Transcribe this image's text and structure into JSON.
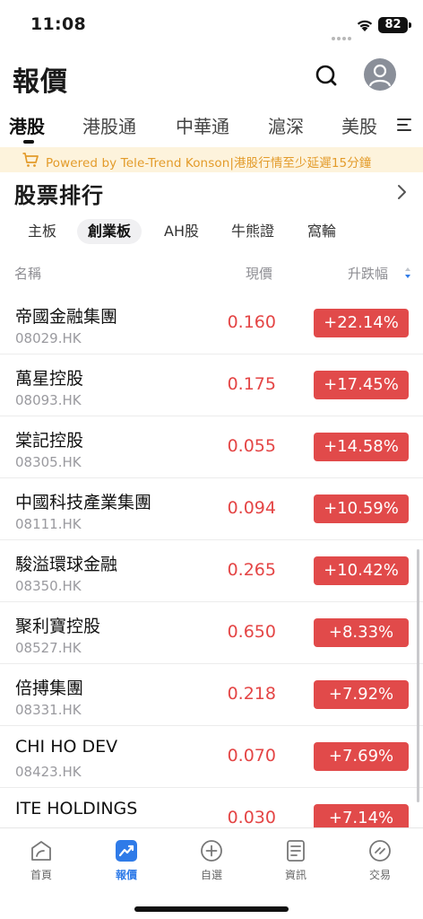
{
  "status_bar": {
    "time": "11:08",
    "battery": "82"
  },
  "header": {
    "title": "報價"
  },
  "market_tabs": [
    {
      "label": "港股",
      "active": true
    },
    {
      "label": "港股通",
      "active": false
    },
    {
      "label": "中華通",
      "active": false
    },
    {
      "label": "滬深",
      "active": false
    },
    {
      "label": "美股",
      "active": false
    }
  ],
  "notice": {
    "text": "Powered by Tele-Trend Konson|港股行情至少延遲15分鐘"
  },
  "section": {
    "title": "股票排行"
  },
  "board_tabs": [
    {
      "label": "主板",
      "active": false
    },
    {
      "label": "創業板",
      "active": true
    },
    {
      "label": "AH股",
      "active": false
    },
    {
      "label": "牛熊證",
      "active": false
    },
    {
      "label": "窩輪",
      "active": false
    }
  ],
  "table_header": {
    "name": "名稱",
    "price": "現價",
    "change": "升跌幅"
  },
  "stocks": [
    {
      "name": "帝國金融集團",
      "code": "08029.HK",
      "price": "0.160",
      "change": "+22.14%"
    },
    {
      "name": "萬星控股",
      "code": "08093.HK",
      "price": "0.175",
      "change": "+17.45%"
    },
    {
      "name": "棠記控股",
      "code": "08305.HK",
      "price": "0.055",
      "change": "+14.58%"
    },
    {
      "name": "中國科技產業集團",
      "code": "08111.HK",
      "price": "0.094",
      "change": "+10.59%"
    },
    {
      "name": "駿溢環球金融",
      "code": "08350.HK",
      "price": "0.265",
      "change": "+10.42%"
    },
    {
      "name": "聚利寶控股",
      "code": "08527.HK",
      "price": "0.650",
      "change": "+8.33%"
    },
    {
      "name": "倍搏集團",
      "code": "08331.HK",
      "price": "0.218",
      "change": "+7.92%"
    },
    {
      "name": "CHI HO DEV",
      "code": "08423.HK",
      "price": "0.070",
      "change": "+7.69%"
    },
    {
      "name": "ITE HOLDINGS",
      "code": "",
      "price": "0.030",
      "change": "+7.14%"
    }
  ],
  "bottom_nav": [
    {
      "label": "首頁",
      "icon": "home-icon",
      "active": false
    },
    {
      "label": "報價",
      "icon": "quotes-chart-icon",
      "active": true
    },
    {
      "label": "自選",
      "icon": "add-circle-icon",
      "active": false
    },
    {
      "label": "資訊",
      "icon": "news-icon",
      "active": false
    },
    {
      "label": "交易",
      "icon": "trade-icon",
      "active": false
    }
  ],
  "colors": {
    "up_red": "#e14a4a",
    "price_red": "#e44545",
    "accent_blue": "#2f7be8",
    "notice_bg": "#fdf3dc",
    "notice_text": "#e39b2a"
  }
}
